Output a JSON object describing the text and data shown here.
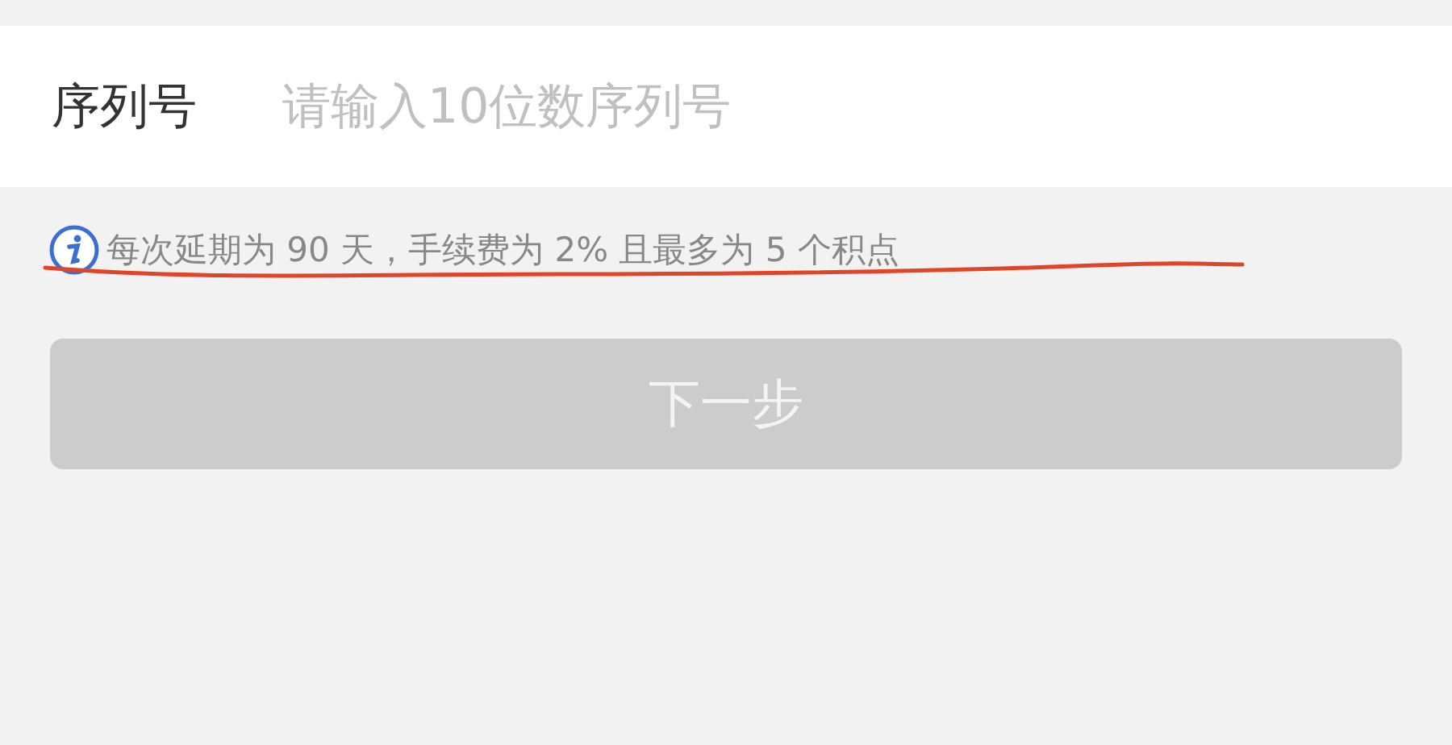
{
  "serial_field": {
    "label": "序列号",
    "placeholder": "请输入10位数序列号"
  },
  "notice": {
    "text": "每次延期为 90 天，手续费为 2% 且最多为 5 个积点"
  },
  "next_button": {
    "label": "下一步",
    "disabled": true
  }
}
